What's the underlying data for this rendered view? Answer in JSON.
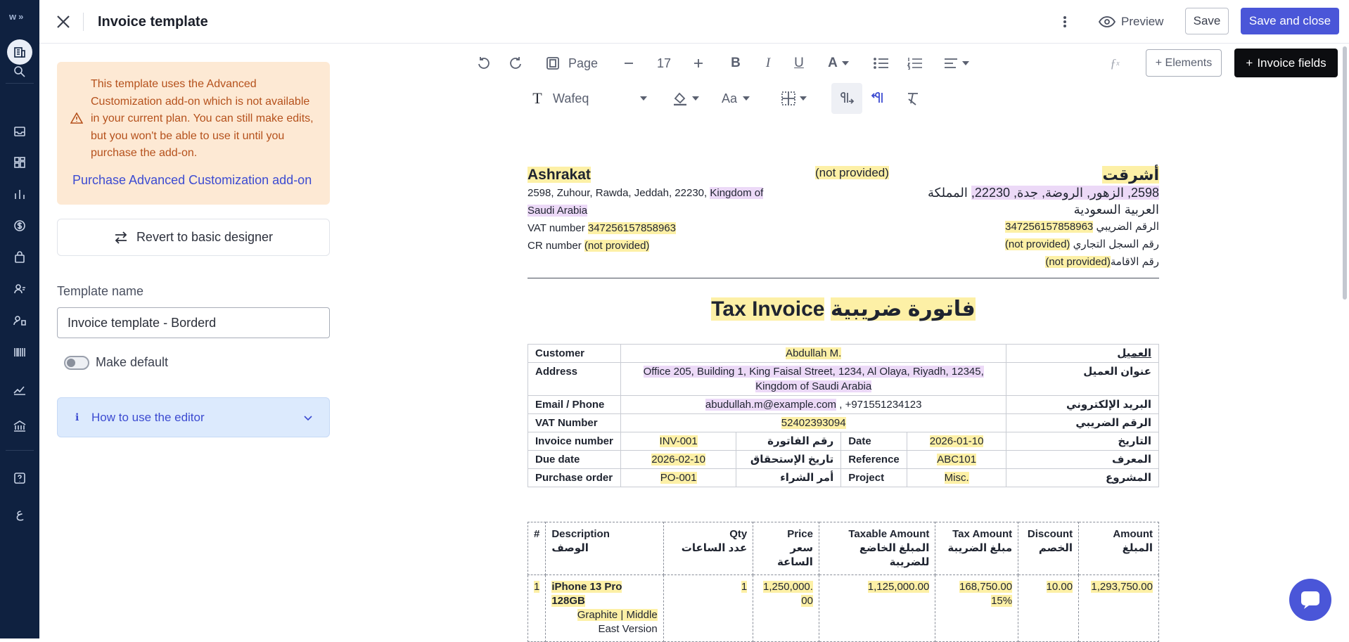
{
  "header": {
    "title": "Invoice template",
    "preview_label": "Preview",
    "save_label": "Save",
    "save_close_label": "Save and close"
  },
  "rail": {
    "logo": "w",
    "logo_suffix": "»"
  },
  "warning": {
    "text": "This template uses the Advanced Customization add-on which is not available in your current plan. You can still make edits, but you won't be able to use it until you purchase the add-on.",
    "link": "Purchase Advanced Customization add-on"
  },
  "revert_label": "Revert to basic designer",
  "template_name": {
    "label": "Template name",
    "value": "Invoice template - Borderd"
  },
  "make_default_label": "Make default",
  "how_to_label": "How to use the editor",
  "toolbar": {
    "page_label": "Page",
    "font_size": "17",
    "font_name": "Wafeq",
    "case_label": "Aa",
    "elements_label": "+ Elements",
    "fields_label": "Invoice fields"
  },
  "doc": {
    "company_en": "Ashrakat",
    "company_address_en_1": "2598, Zuhour, Rawda, Jeddah, 22230,",
    "company_address_en_country": "Kingdom of Saudi Arabia",
    "vat_label_en": "VAT number",
    "vat_value": "347256157858963",
    "cr_label_en": "CR number",
    "not_provided": "(not provided)",
    "not_provided_word": "provided",
    "logo_placeholder": "(not provided)",
    "company_ar": "أشرقت",
    "company_address_ar_1": "2598, الزهور, الروضة, جدة, 22230,",
    "company_address_ar_2": "المملكة العربية السعودية",
    "vat_label_ar": "الرقم الضريبي",
    "cr_label_ar": "رقم السجل التجاري",
    "iqama_label_ar": "رقم الاقامة",
    "title_en": "Tax Invoice",
    "title_ar": "فاتورة ضريبية",
    "customer": {
      "label_en": "Customer",
      "label_ar": "العميل",
      "value": "Abdullah M.",
      "address_label_en": "Address",
      "address_label_ar": "عنوان العميل",
      "address": "Office 205, Building 1, King Faisal Street, 1234, Al Olaya, Riyadh, 12345, Kingdom of Saudi Arabia",
      "email_label_en": "Email / Phone",
      "email_label_ar": "البريد الإلكتروني",
      "email": "abudullah.m@example.com",
      "phone": "+971551234123",
      "vat_label_en": "VAT Number",
      "vat_label_ar": "الرقم الضريبي",
      "vat": "52402393094"
    },
    "meta": {
      "inv_no_label_en": "Invoice number",
      "inv_no_label_ar": "رقم الفاتورة",
      "inv_no": "INV-001",
      "date_label_en": "Date",
      "date_label_ar": "التاريخ",
      "date": "2026-01-10",
      "due_label_en": "Due date",
      "due_label_ar": "تاريخ الإستحقاق",
      "due": "2026-02-10",
      "ref_label_en": "Reference",
      "ref_label_ar": "المعرف",
      "ref": "ABC101",
      "po_label_en": "Purchase order",
      "po_label_ar": "أمر الشراء",
      "po": "PO-001",
      "project_label_en": "Project",
      "project_label_ar": "المشروع",
      "project": "Misc."
    },
    "items_header": {
      "num": "#",
      "desc_en": "Description",
      "desc_ar": "الوصف",
      "qty_en": "Qty",
      "qty_ar": "عدد الساعات",
      "price_en": "Price",
      "price_ar": "سعر الساعة",
      "taxable_en": "Taxable Amount",
      "taxable_ar": "المبلغ الخاضع للضريبة",
      "tax_en": "Tax Amount",
      "tax_ar": "مبلغ الضريبة",
      "discount_en": "Discount",
      "discount_ar": "الخصم",
      "amount_en": "Amount",
      "amount_ar": "المبلغ"
    },
    "items": [
      {
        "num": "1",
        "name": "iPhone 13 Pro 128GB",
        "variant": "Graphite | Middle",
        "variant_2": "East Version",
        "qty": "1",
        "price": "1,250,000.00",
        "taxable": "1,125,000.00",
        "tax": "168,750.00",
        "tax_rate": "15%",
        "discount": "10.00",
        "amount": "1,293,750.00"
      }
    ]
  }
}
